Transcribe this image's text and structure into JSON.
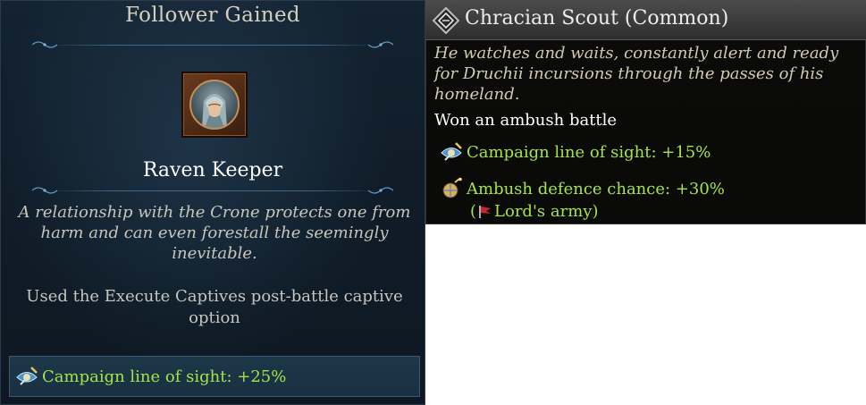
{
  "follower_gained_panel": {
    "title": "Follower Gained",
    "follower_name": "Raven Keeper",
    "description": "A relationship with the Crone protects one from harm and can even forestall the seemingly inevitable.",
    "trigger": "Used the Execute Captives post-battle captive option",
    "effect": {
      "icon": "line-of-sight-icon",
      "text": "Campaign line of sight: +25%"
    }
  },
  "follower_tooltip": {
    "title": "Chracian Scout (Common)",
    "flavor_text": "He watches and waits, constantly alert and ready for Druchii incursions through the passes of his homeland.",
    "trigger": "Won an ambush battle",
    "effects": [
      {
        "icon": "line-of-sight-icon",
        "text": "Campaign line of sight: +15%"
      },
      {
        "icon": "ambush-defence-icon",
        "text": "Ambush defence chance: +30%"
      }
    ],
    "scope": {
      "open": "(",
      "icon": "lords-army-flag-icon",
      "label": "Lord's army",
      "close": ")"
    }
  },
  "colors": {
    "effect_green": "#a4e34a",
    "panel_navy": "#101c28",
    "tooltip_black": "#0a0a08",
    "header_grey": "#3b3b3b"
  }
}
